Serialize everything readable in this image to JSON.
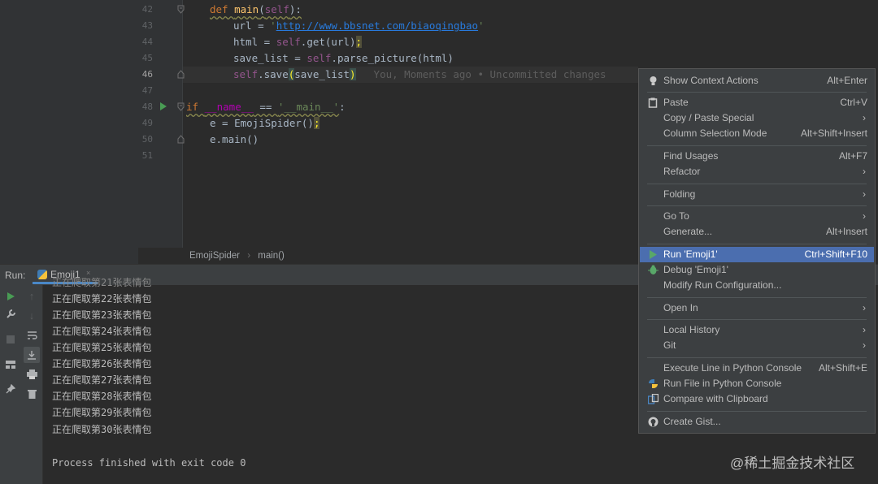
{
  "editor": {
    "line_numbers": [
      "42",
      "43",
      "44",
      "45",
      "46",
      "47",
      "48",
      "49",
      "50",
      "51"
    ],
    "code": {
      "l42_kw": "def ",
      "l42_fn": "main",
      "l42_open": "(",
      "l42_self": "self",
      "l42_close": "):",
      "l43_pre": "url = ",
      "l43_q1": "'",
      "l43_url": "http://www.bbsnet.com/biaoqingbao",
      "l43_q2": "'",
      "l44_pre": "html = ",
      "l44_self": "self",
      "l44_post": ".get(url)",
      "l44_semi": ";",
      "l45_pre": "save_list = ",
      "l45_self": "self",
      "l45_post": ".parse_picture(html)",
      "l46_self": "self",
      "l46_mid": ".save",
      "l46_open": "(",
      "l46_arg": "save_list",
      "l46_close": ")",
      "l46_blame": "You, Moments ago • Uncommitted changes",
      "l48_kw": "if ",
      "l48_name": "__name__",
      "l48_eq": " == ",
      "l48_str": "'__main__'",
      "l48_colon": ":",
      "l49_pre": "e = EmojiSpider()",
      "l49_semi": ";",
      "l50_pre": "e.main()"
    },
    "breadcrumb": [
      "EmojiSpider",
      "main()"
    ]
  },
  "run_panel": {
    "label": "Run:",
    "tab_name": "Emoji1",
    "tab_close": "×",
    "partial_line": "正在爬取第21张表情包",
    "output_lines": [
      "正在爬取第22张表情包",
      "正在爬取第23张表情包",
      "正在爬取第24张表情包",
      "正在爬取第25张表情包",
      "正在爬取第26张表情包",
      "正在爬取第27张表情包",
      "正在爬取第28张表情包",
      "正在爬取第29张表情包",
      "正在爬取第30张表情包"
    ],
    "exit_message": "Process finished with exit code 0"
  },
  "context_menu": {
    "items": [
      {
        "label": "Show Context Actions",
        "shortcut": "Alt+Enter",
        "icon": "lightbulb-icon"
      },
      {
        "label": "Paste",
        "shortcut": "Ctrl+V",
        "icon": "clipboard-icon"
      },
      {
        "label": "Copy / Paste Special",
        "shortcut": "",
        "submenu": true
      },
      {
        "label": "Column Selection Mode",
        "shortcut": "Alt+Shift+Insert"
      },
      {
        "label": "Find Usages",
        "shortcut": "Alt+F7"
      },
      {
        "label": "Refactor",
        "shortcut": "",
        "submenu": true
      },
      {
        "label": "Folding",
        "shortcut": "",
        "submenu": true
      },
      {
        "label": "Go To",
        "shortcut": "",
        "submenu": true
      },
      {
        "label": "Generate...",
        "shortcut": "Alt+Insert"
      },
      {
        "label": "Run 'Emoji1'",
        "shortcut": "Ctrl+Shift+F10",
        "icon": "run-icon",
        "selected": true
      },
      {
        "label": "Debug 'Emoji1'",
        "shortcut": "",
        "icon": "debug-icon"
      },
      {
        "label": "Modify Run Configuration...",
        "shortcut": ""
      },
      {
        "label": "Open In",
        "shortcut": "",
        "submenu": true
      },
      {
        "label": "Local History",
        "shortcut": "",
        "submenu": true
      },
      {
        "label": "Git",
        "shortcut": "",
        "submenu": true
      },
      {
        "label": "Execute Line in Python Console",
        "shortcut": "Alt+Shift+E"
      },
      {
        "label": "Run File in Python Console",
        "shortcut": "",
        "icon": "python-icon"
      },
      {
        "label": "Compare with Clipboard",
        "shortcut": "",
        "icon": "compare-icon"
      },
      {
        "label": "Create Gist...",
        "shortcut": "",
        "icon": "github-icon"
      }
    ],
    "arrow": "›"
  },
  "watermark": "@稀土掘金技术社区",
  "colors": {
    "editor_bg": "#2b2b2b",
    "gutter_bg": "#313335",
    "panel_bg": "#3c3f41",
    "selection": "#4b6eaf",
    "keyword": "#cc7832",
    "string": "#6a8759",
    "function": "#ffc66d",
    "self": "#94558d",
    "run_green": "#499c54"
  }
}
